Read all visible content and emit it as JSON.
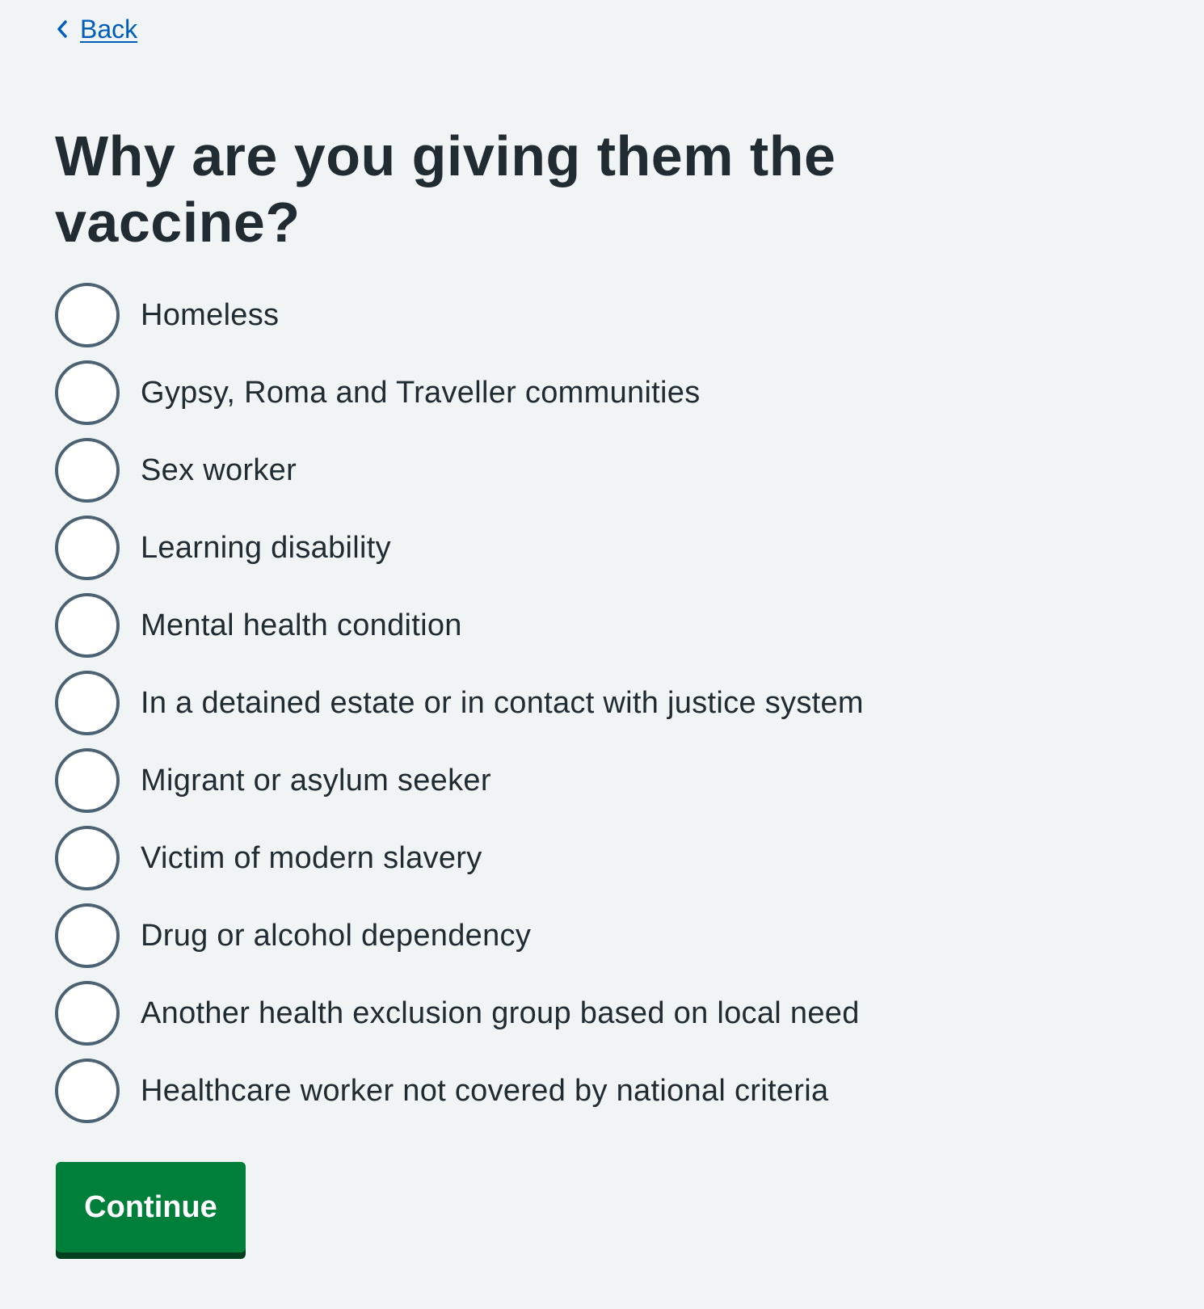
{
  "back_link": {
    "label": "Back",
    "icon": "chevron-left-icon"
  },
  "page_title": "Why are you giving them the vaccine?",
  "options": [
    {
      "label": "Homeless",
      "selected": false
    },
    {
      "label": "Gypsy, Roma and Traveller communities",
      "selected": false
    },
    {
      "label": "Sex worker",
      "selected": false
    },
    {
      "label": "Learning disability",
      "selected": false
    },
    {
      "label": "Mental health condition",
      "selected": false
    },
    {
      "label": "In a detained estate or in contact with justice system",
      "selected": false
    },
    {
      "label": "Migrant or asylum seeker",
      "selected": false
    },
    {
      "label": "Victim of modern slavery",
      "selected": false
    },
    {
      "label": "Drug or alcohol dependency",
      "selected": false
    },
    {
      "label": "Another health exclusion group based on local need",
      "selected": false
    },
    {
      "label": "Healthcare worker not covered by national criteria",
      "selected": false
    }
  ],
  "continue_button": {
    "label": "Continue"
  },
  "colors": {
    "background": "#f0f4f5",
    "link": "#005eb8",
    "text": "#212b32",
    "radio_border": "#4c6272",
    "button": "#007f3b",
    "button_shadow": "#00401e"
  }
}
